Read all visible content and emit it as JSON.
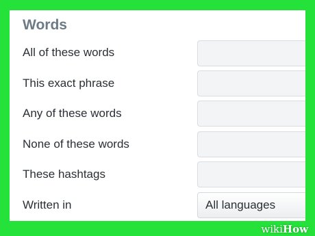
{
  "section": {
    "title": "Words"
  },
  "rows": [
    {
      "label": "All of these words",
      "value": ""
    },
    {
      "label": "This exact phrase",
      "value": ""
    },
    {
      "label": "Any of these words",
      "value": ""
    },
    {
      "label": "None of these words",
      "value": ""
    },
    {
      "label": "These hashtags",
      "value": ""
    }
  ],
  "language": {
    "label": "Written in",
    "selected": "All languages"
  },
  "watermark": {
    "part1": "wiki",
    "part2": "How"
  },
  "colors": {
    "frame": "#25e23a",
    "title": "#6c7a86",
    "input_bg": "#f2f4f6"
  }
}
